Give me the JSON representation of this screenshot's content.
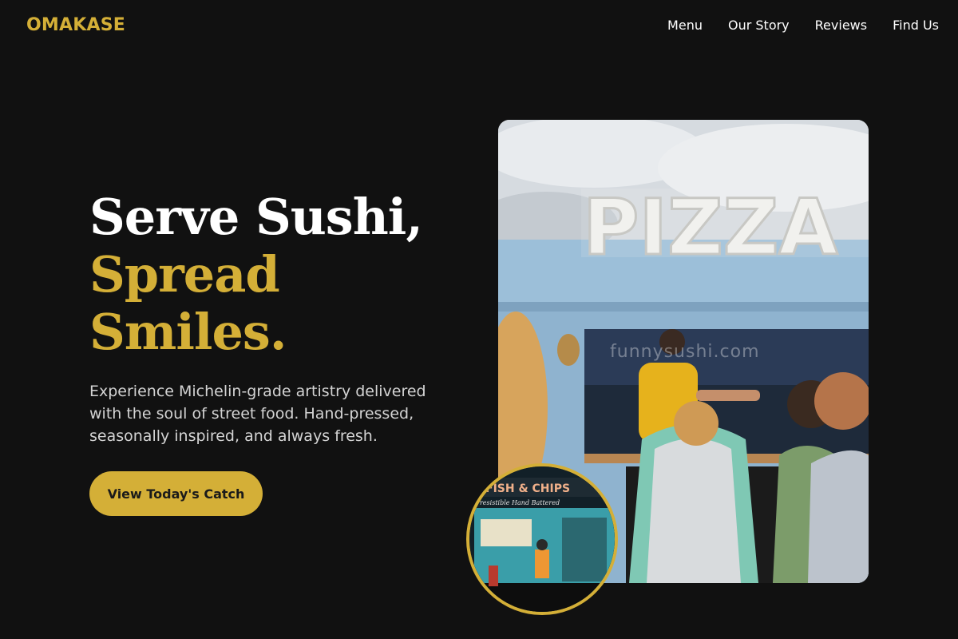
{
  "brand": {
    "name": "OMAKASE",
    "color": "#d4af37"
  },
  "nav": [
    {
      "label": "Menu"
    },
    {
      "label": "Our Story"
    },
    {
      "label": "Reviews"
    },
    {
      "label": "Find Us"
    }
  ],
  "hero": {
    "title_line1": "Serve Sushi,",
    "title_line2": "Spread",
    "title_line3": "Smiles.",
    "description": "Experience Michelin-grade artistry delivered with the soul of street food. Hand-pressed, seasonally inspired, and always fresh.",
    "cta_label": "View Today's Catch"
  },
  "main_photo": {
    "sign_text": "PIZZA",
    "watermark": "funnysushi.com"
  },
  "inset_photo": {
    "sign_text": "FISH & CHIPS",
    "subsign_text": "Irresistible Hand Battered"
  }
}
